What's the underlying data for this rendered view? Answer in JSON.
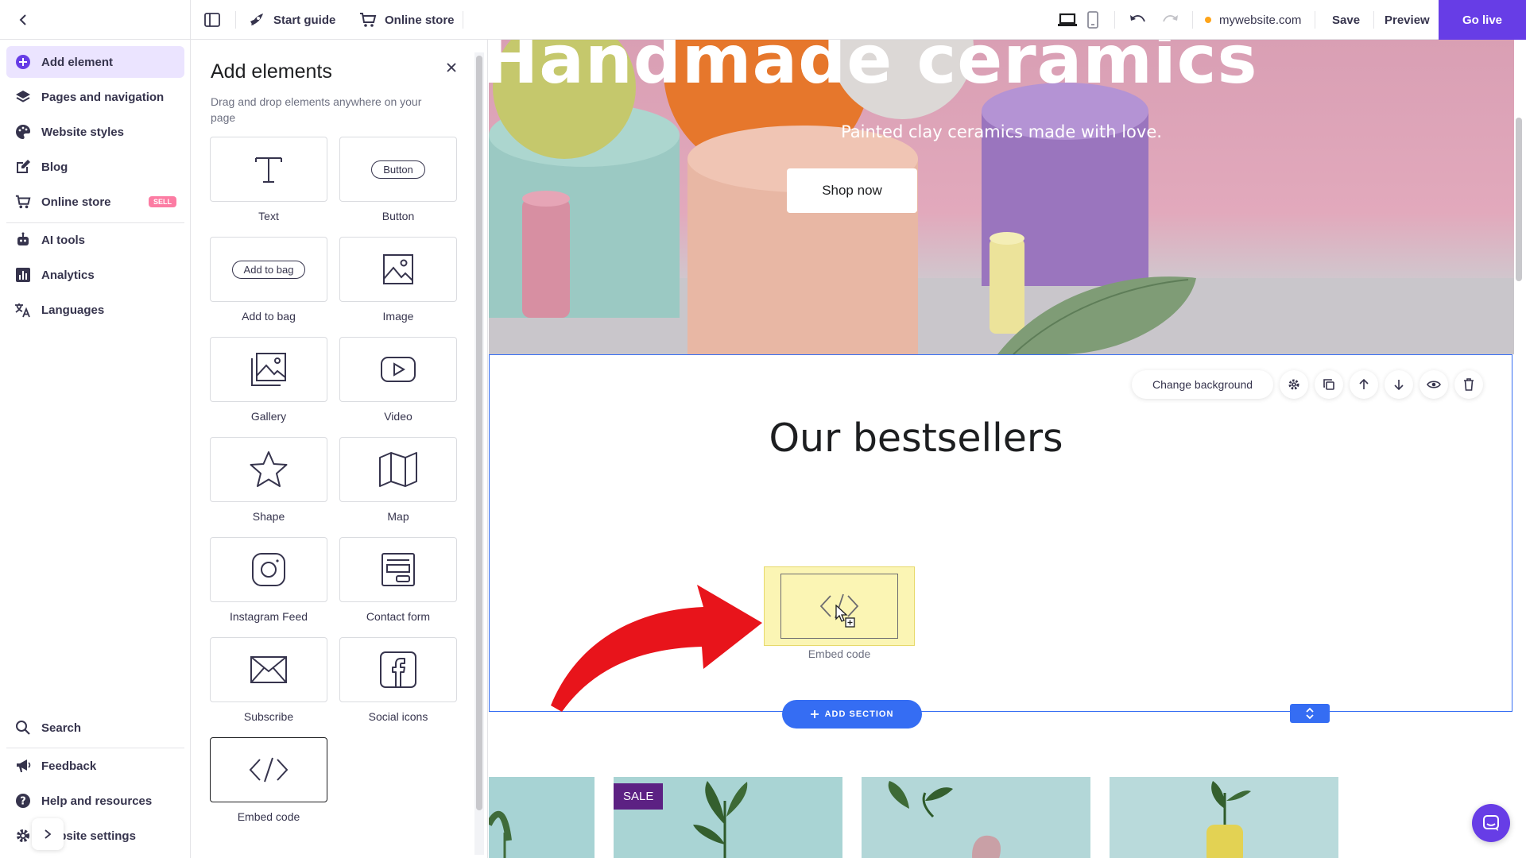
{
  "topbar": {
    "start_guide": "Start guide",
    "online_store": "Online store",
    "domain": "mywebsite.com",
    "save": "Save",
    "preview": "Preview",
    "go_live": "Go live"
  },
  "sidebar": {
    "items": [
      {
        "label": "Add element",
        "icon": "plus-circle-icon"
      },
      {
        "label": "Pages and navigation",
        "icon": "layers-icon"
      },
      {
        "label": "Website styles",
        "icon": "palette-icon"
      },
      {
        "label": "Blog",
        "icon": "edit-icon"
      },
      {
        "label": "Online store",
        "icon": "cart-icon",
        "badge": "SELL"
      },
      {
        "label": "AI tools",
        "icon": "robot-icon"
      },
      {
        "label": "Analytics",
        "icon": "chart-icon"
      },
      {
        "label": "Languages",
        "icon": "translate-icon"
      }
    ],
    "bottom": [
      {
        "label": "Search",
        "icon": "search-icon"
      },
      {
        "label": "Feedback",
        "icon": "megaphone-icon"
      },
      {
        "label": "Help and resources",
        "icon": "help-icon"
      },
      {
        "label": "Website settings",
        "icon": "gear-icon"
      }
    ]
  },
  "panel": {
    "title": "Add elements",
    "subtitle": "Drag and drop elements anywhere on your page",
    "tiles": [
      {
        "label": "Text",
        "sample": "T"
      },
      {
        "label": "Button",
        "sample": "Button"
      },
      {
        "label": "Add to bag",
        "sample": "Add to bag"
      },
      {
        "label": "Image"
      },
      {
        "label": "Gallery"
      },
      {
        "label": "Video"
      },
      {
        "label": "Shape"
      },
      {
        "label": "Map"
      },
      {
        "label": "Instagram Feed"
      },
      {
        "label": "Contact form"
      },
      {
        "label": "Subscribe"
      },
      {
        "label": "Social icons"
      },
      {
        "label": "Embed code"
      }
    ]
  },
  "hero": {
    "title": "Handmade ceramics",
    "subtitle": "Painted clay ceramics made with love.",
    "cta": "Shop now"
  },
  "section": {
    "toolbar_change_bg": "Change background",
    "title": "Our bestsellers",
    "embed_caption": "Embed code",
    "add_section": "ADD SECTION"
  },
  "products": {
    "sale_badge": "SALE"
  },
  "colors": {
    "accent": "#673de6",
    "selection_blue": "#356df3",
    "drop_yellow": "#fbf5b4",
    "arrow_red": "#e8141b"
  }
}
